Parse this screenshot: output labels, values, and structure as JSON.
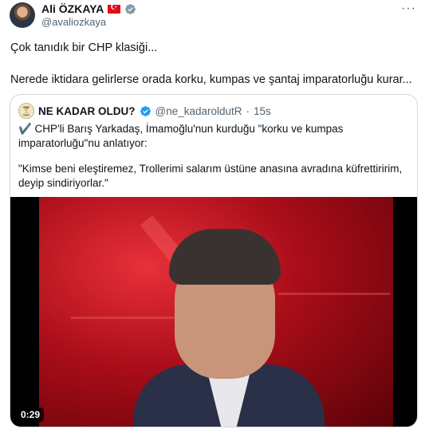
{
  "tweet": {
    "author_name": "Ali ÖZKAYA",
    "author_handle": "@avaliozkaya",
    "flag_icon": "turkey-flag-icon",
    "verified_color": "#829aab",
    "more_label": "···",
    "line1": "Çok tanıdık bir CHP klasiği...",
    "line2": "Nerede iktidara gelirlerse orada korku, kumpas ve şantaj imparatorluğu kurar..."
  },
  "quote": {
    "author_name": "NE KADAR OLDU?",
    "author_handle": "@ne_kadaroldutR",
    "separator": "·",
    "time": "15s",
    "verified_color": "#1d9bf0",
    "paragraph1": "✔️ CHP'li Barış Yarkadaş, İmamoğlu'nun kurduğu \"korku ve kumpas imparatorluğu\"nu anlatıyor:",
    "paragraph2": "\"Kimse beni eleştiremez, Trollerimi salarım üstüne anasına avradına küfrettiririm, deyip sindiriyorlar.\"",
    "video_duration": "0:29"
  }
}
